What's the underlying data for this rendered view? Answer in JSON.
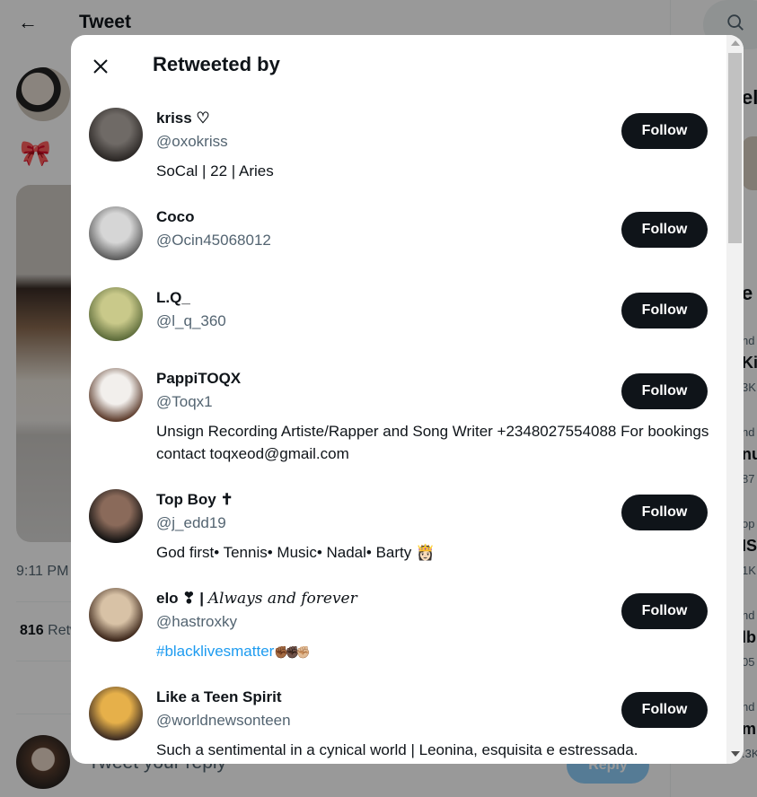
{
  "background": {
    "header_title": "Tweet",
    "tweet_time": "9:11 PM",
    "retweet_count": "816",
    "retweet_label": "Retweets",
    "reply_placeholder": "Tweet your reply",
    "reply_button": "Reply",
    "sidebar_fragments": [
      "el",
      "e",
      "nd",
      "Kin",
      "3K",
      "nd",
      "nu",
      "87",
      "op",
      "IS",
      "1K",
      "nd",
      "lb",
      "05",
      "nd",
      "m",
      ".3K"
    ]
  },
  "modal": {
    "title": "Retweeted by",
    "close_icon": "close-icon",
    "follow_label": "Follow",
    "users": [
      {
        "name": "kriss ♡",
        "handle": "@oxokriss",
        "bio": "SoCal | 22 | Aries",
        "avatar_colors": [
          "#6f6a66",
          "#2a2624"
        ]
      },
      {
        "name": "Coco",
        "handle": "@Ocin45068012",
        "bio": "",
        "avatar_colors": [
          "#d6d6d6",
          "#5b5b5b"
        ]
      },
      {
        "name": "L.Q_",
        "handle": "@l_q_360",
        "bio": "",
        "avatar_colors": [
          "#c9c98a",
          "#5c6b3a"
        ]
      },
      {
        "name": "PappiTOQX",
        "handle": "@Toqx1",
        "bio": "Unsign Recording Artiste/Rapper and Song Writer +2348027554088 For bookings contact toqxeod@gmail.com",
        "avatar_colors": [
          "#f2efec",
          "#5b3a2a"
        ]
      },
      {
        "name": "Top Boy ✝",
        "handle": "@j_edd19",
        "bio": "God first• Tennis• Music• Nadal• Barty 👸🏻",
        "avatar_colors": [
          "#8a6a5a",
          "#101010"
        ]
      },
      {
        "name": "elo ❣ | ",
        "name_italic": "Always and forever",
        "handle": "@hastroxky",
        "bio_hashtag": "#blacklivesmatter",
        "bio_suffix": "✊🏾✊🏿✊🏼",
        "avatar_colors": [
          "#d8c2a6",
          "#3a2418"
        ]
      },
      {
        "name": "Like a Teen Spirit",
        "handle": "@worldnewsonteen",
        "bio": "Such a sentimental in a cynical world | Leonina, esquisita e estressada.",
        "avatar_colors": [
          "#e6b04a",
          "#3a2a22"
        ]
      }
    ]
  }
}
